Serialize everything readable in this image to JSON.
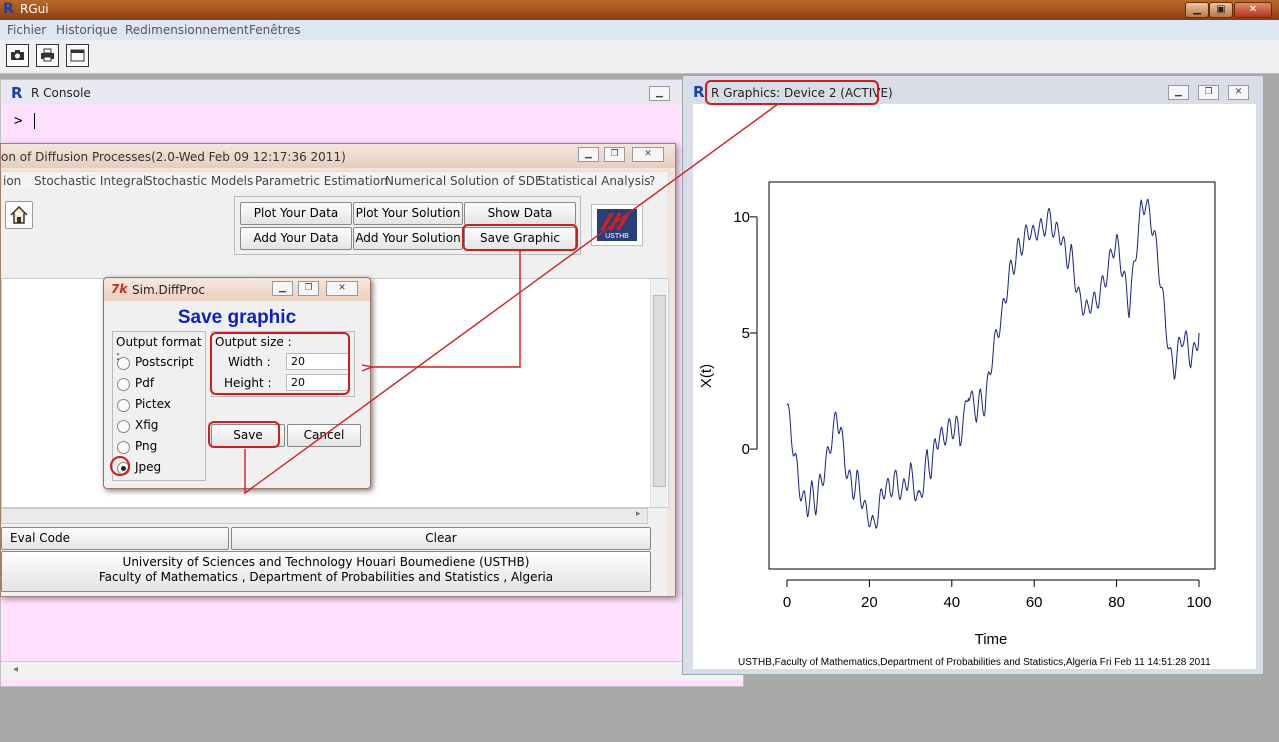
{
  "app": {
    "title": "RGui"
  },
  "menubar": {
    "items": [
      "Fichier",
      "Historique",
      "Redimensionnement",
      "Fenêtres"
    ]
  },
  "toolbar": {
    "icons": [
      "camera-icon",
      "printer-icon",
      "window-icon"
    ]
  },
  "console": {
    "title": "R Console",
    "prompt": ">"
  },
  "diffusion": {
    "title": "on of Diffusion Processes(2.0-Wed Feb 09 12:17:36 2011)",
    "menu": [
      "ion",
      "Stochastic Integral",
      "Stochastic Models",
      "Parametric Estimation",
      "Numerical Solution of SDE",
      "Statistical Analysis",
      "?"
    ],
    "buttons": {
      "plot_data": "Plot Your Data",
      "plot_solution": "Plot Your Solution",
      "show_data": "Show Data",
      "add_data": "Add Your Data",
      "add_solution": "Add Your Solution",
      "save_graphic": "Save Graphic",
      "eval_code": "Eval Code",
      "clear": "Clear"
    },
    "footer": {
      "line1": "University of Sciences and Technology Houari Boumediene (USTHB)",
      "line2": "Faculty of Mathematics , Department of Probabilities and Statistics , Algeria"
    },
    "logo_text": "USTHB"
  },
  "dialog": {
    "title": "Sim.DiffProc",
    "heading": "Save graphic",
    "format_label": "Output format :",
    "formats": [
      "Postscript",
      "Pdf",
      "Pictex",
      "Xfig",
      "Png",
      "Jpeg"
    ],
    "selected_format": "Jpeg",
    "size_label": "Output size :",
    "width_label": "Width :",
    "height_label": "Height :",
    "width_value": "20",
    "height_value": "20",
    "save": "Save",
    "cancel": "Cancel"
  },
  "graphics": {
    "title": "R Graphics: Device 2 (ACTIVE)",
    "footer": "USTHB,Faculty of Mathematics,Department of Probabilities and Statistics,Algeria Fri Feb 11 14:51:28 2011"
  },
  "colors": {
    "line": "#1a237e",
    "annotation": "#cc2020",
    "console_bg": "#ffe0ff"
  },
  "chart_data": {
    "type": "line",
    "xlabel": "Time",
    "ylabel": "X(t)",
    "xlim": [
      0,
      100
    ],
    "ylim": [
      -4,
      11.5
    ],
    "xticks": [
      "0",
      "20",
      "40",
      "60",
      "80",
      "100"
    ],
    "yticks": [
      "0",
      "5",
      "10"
    ],
    "x": [
      0,
      1,
      2,
      3,
      4,
      5,
      6,
      7,
      8,
      9,
      10,
      11,
      12,
      13,
      14,
      15,
      16,
      17,
      18,
      19,
      20,
      21,
      22,
      23,
      24,
      25,
      26,
      27,
      28,
      29,
      30,
      31,
      32,
      33,
      34,
      35,
      36,
      37,
      38,
      39,
      40,
      41,
      42,
      43,
      44,
      45,
      46,
      47,
      48,
      49,
      50,
      51,
      52,
      53,
      54,
      55,
      56,
      57,
      58,
      59,
      60,
      61,
      62,
      63,
      64,
      65,
      66,
      67,
      68,
      69,
      70,
      71,
      72,
      73,
      74,
      75,
      76,
      77,
      78,
      79,
      80,
      81,
      82,
      83,
      84,
      85,
      86,
      87,
      88,
      89,
      90,
      91,
      92,
      93,
      94,
      95,
      96,
      97,
      98,
      99,
      100
    ],
    "y": [
      1.9,
      0.7,
      -0.4,
      -1.6,
      -2.2,
      -2.5,
      -1.8,
      -2.4,
      -1.5,
      -1.0,
      -0.2,
      0.6,
      1.4,
      0.9,
      -0.5,
      -1.2,
      -1.8,
      -1.3,
      -2.0,
      -2.7,
      -2.9,
      -3.4,
      -2.8,
      -2.0,
      -1.5,
      -1.9,
      -1.2,
      -1.6,
      -1.9,
      -1.4,
      -1.0,
      -1.7,
      -2.3,
      -1.5,
      -0.4,
      -0.9,
      0.2,
      0.6,
      0.4,
      0.9,
      0.8,
      1.1,
      0.5,
      1.3,
      2.6,
      2.0,
      1.6,
      2.2,
      1.8,
      3.1,
      4.2,
      5.0,
      5.6,
      6.5,
      7.6,
      7.9,
      8.6,
      8.8,
      9.2,
      9.5,
      9.1,
      9.6,
      9.4,
      9.8,
      10.0,
      9.2,
      9.5,
      8.8,
      8.2,
      8.4,
      7.3,
      6.4,
      6.2,
      5.9,
      6.5,
      6.2,
      6.8,
      7.2,
      7.8,
      8.6,
      8.9,
      8.1,
      7.2,
      6.1,
      7.5,
      9.0,
      10.4,
      10.6,
      10.1,
      9.4,
      8.2,
      6.8,
      5.3,
      4.0,
      3.4,
      4.3,
      4.9,
      4.6,
      3.9,
      4.2,
      5.0
    ]
  }
}
